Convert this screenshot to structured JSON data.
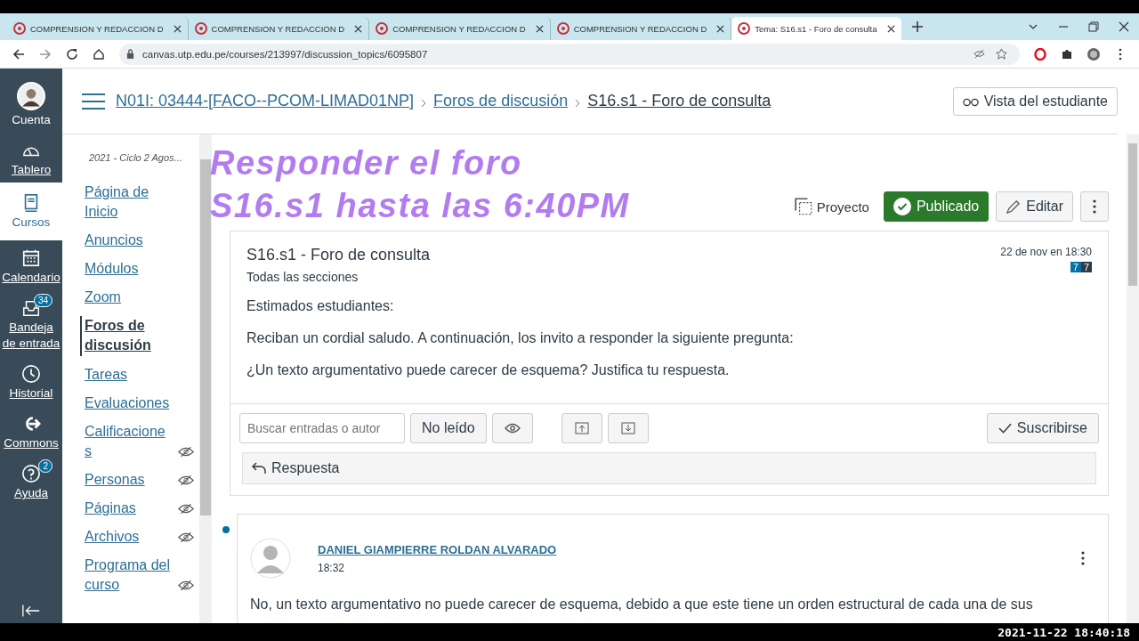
{
  "browser": {
    "tabs": [
      {
        "title": "COMPRENSION Y REDACCION D",
        "selected": false
      },
      {
        "title": "COMPRENSION Y REDACCION D",
        "selected": false
      },
      {
        "title": "COMPRENSION Y REDACCION D",
        "selected": false
      },
      {
        "title": "COMPRENSION Y REDACCION D",
        "selected": false
      },
      {
        "title": "Tema: S16.s1 - Foro de consulta",
        "selected": true
      }
    ],
    "url": "canvas.utp.edu.pe/courses/213997/discussion_topics/6095807"
  },
  "global_nav": [
    {
      "label": "Cuenta",
      "kind": "avatar",
      "selected": false
    },
    {
      "label": "Tablero",
      "kind": "dashboard",
      "selected": false
    },
    {
      "label": "Cursos",
      "kind": "book",
      "selected": true
    },
    {
      "label": "Calendario",
      "kind": "calendar",
      "selected": false
    },
    {
      "label": "Bandeja de entrada",
      "kind": "inbox",
      "selected": false,
      "badge": "34"
    },
    {
      "label": "Historial",
      "kind": "clock",
      "selected": false
    },
    {
      "label": "Commons",
      "kind": "commons",
      "selected": false
    },
    {
      "label": "Ayuda",
      "kind": "help",
      "selected": false,
      "badge": "2"
    }
  ],
  "breadcrumbs": [
    "N01I: 03444-[FACO--PCOM-LIMAD01NP]",
    "Foros de discusión",
    "S16.s1 - Foro de consulta"
  ],
  "student_view_button": "Vista del estudiante",
  "course_nav": {
    "term": "2021 - Ciclo 2 Agos...",
    "items": [
      {
        "label": "Página de Inicio",
        "selected": false,
        "hidden": false
      },
      {
        "label": "Anuncios",
        "selected": false,
        "hidden": false
      },
      {
        "label": "Módulos",
        "selected": false,
        "hidden": false
      },
      {
        "label": "Zoom",
        "selected": false,
        "hidden": false
      },
      {
        "label": "Foros de discusión",
        "selected": true,
        "hidden": false
      },
      {
        "label": "Tareas",
        "selected": false,
        "hidden": false
      },
      {
        "label": "Evaluaciones",
        "selected": false,
        "hidden": false
      },
      {
        "label": "Calificaciones",
        "selected": false,
        "hidden": true
      },
      {
        "label": "Personas",
        "selected": false,
        "hidden": true
      },
      {
        "label": "Páginas",
        "selected": false,
        "hidden": true
      },
      {
        "label": "Archivos",
        "selected": false,
        "hidden": true
      },
      {
        "label": "Programa del curso",
        "selected": false,
        "hidden": true
      }
    ]
  },
  "overlay_caption": [
    "Responder el foro",
    "S16.s1 hasta las 6:40PM"
  ],
  "topic_actions": {
    "project": "Proyecto",
    "published": "Publicado",
    "edit": "Editar"
  },
  "topic": {
    "title": "S16.s1 - Foro de consulta",
    "sections": "Todas las secciones",
    "date": "22 de nov en 18:30",
    "unread_count": "7",
    "total_count": "7",
    "body": [
      "Estimados estudiantes:",
      "Reciban un cordial saludo. A continuación, los invito a responder la siguiente pregunta:",
      "¿Un texto argumentativo puede carecer de esquema? Justifica tu respuesta."
    ]
  },
  "toolbar": {
    "search_placeholder": "Buscar entradas o autor",
    "unread_button": "No leído",
    "subscribe_button": "Suscribirse"
  },
  "reply_button": "Respuesta",
  "entries": [
    {
      "author": "DANIEL GIAMPIERRE ROLDAN ALVARADO",
      "time": "18:32",
      "unread": true,
      "text": "No, un texto argumentativo no puede carecer de esquema, debido a que este tiene un orden estructural de cada una de sus"
    }
  ],
  "video_timestamp": "2021-11-22 18:40:18"
}
